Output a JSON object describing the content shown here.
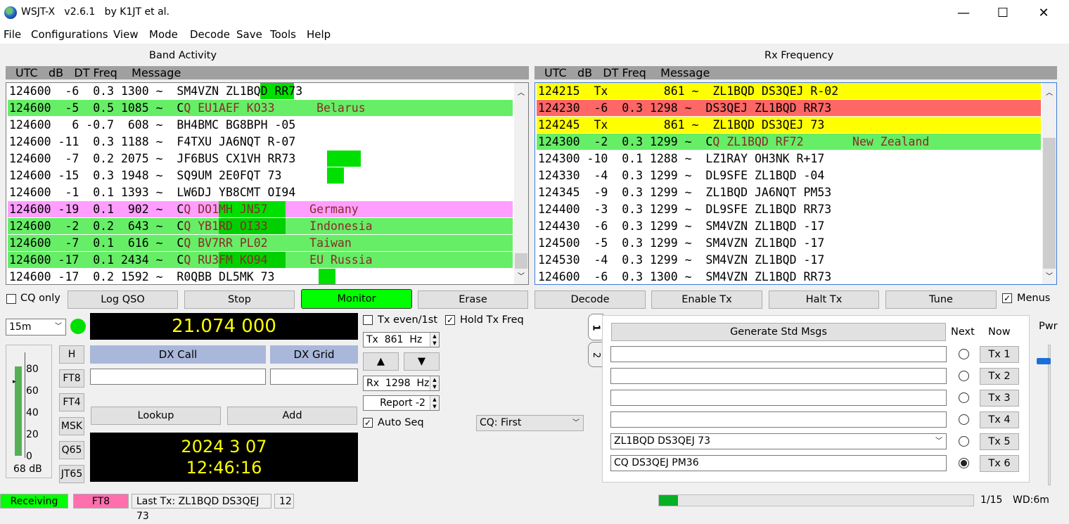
{
  "title": "WSJT-X   v2.6.1   by K1JT et al.",
  "window": {
    "minimize": "—",
    "maximize": "☐",
    "close": "✕"
  },
  "menu": [
    "File",
    "Configurations",
    "View",
    "Mode",
    "Decode",
    "Save",
    "Tools",
    "Help"
  ],
  "band": {
    "title": "Band Activity",
    "header": "UTC   dB   DT Freq    Message",
    "rows": [
      {
        "text": "124600  -6  0.3 1300 ~  SM4VZN ZL1BQD RR73",
        "bg": "#ffffff",
        "hl": [
          {
            "c": "#00e000",
            "from": 30,
            "len": 4
          }
        ]
      },
      {
        "text": "124600  -5  0.5 1085 ~  CQ EU1AEF KO33      Belarus",
        "bg": "#66ee66",
        "fg": "#8a2a2a",
        "hl": []
      },
      {
        "text": "124600   6 -0.7  608 ~  BH4BMC BG8BPH -05",
        "bg": "#ffffff",
        "hl": []
      },
      {
        "text": "124600 -11  0.3 1188 ~  F4TXU JA6NQT R-07",
        "bg": "#ffffff",
        "hl": []
      },
      {
        "text": "124600  -7  0.2 2075 ~  JF6BUS CX1VH RR73",
        "bg": "#ffffff",
        "hl": [
          {
            "c": "#00e000",
            "from": 38,
            "len": 4
          }
        ]
      },
      {
        "text": "124600 -15  0.3 1948 ~  SQ9UM 2E0FQT 73",
        "bg": "#ffffff",
        "hl": [
          {
            "c": "#00e000",
            "from": 38,
            "len": 2
          }
        ]
      },
      {
        "text": "124600  -1  0.1 1393 ~  LW6DJ YB8CMT OI94",
        "bg": "#ffffff",
        "hl": []
      },
      {
        "text": "124600 -19  0.1  902 ~  CQ DO1MH JN57      Germany",
        "bg": "#ff9eff",
        "fg": "#8a2a2a",
        "hl": [
          {
            "c": "#00e000",
            "from": 25,
            "len": 8
          }
        ]
      },
      {
        "text": "124600  -2  0.2  643 ~  CQ YB1RD OI33      Indonesia",
        "bg": "#66ee66",
        "fg": "#8a2a2a",
        "hl": [
          {
            "c": "#00d000",
            "from": 25,
            "len": 8
          }
        ]
      },
      {
        "text": "124600  -7  0.1  616 ~  CQ BV7RR PL02      Taiwan",
        "bg": "#66ee66",
        "fg": "#8a2a2a",
        "hl": []
      },
      {
        "text": "124600 -17  0.1 2434 ~  CQ RU3FM KO94      EU Russia",
        "bg": "#66ee66",
        "fg": "#8a2a2a",
        "hl": [
          {
            "c": "#00d000",
            "from": 25,
            "len": 8
          }
        ]
      },
      {
        "text": "124600 -17  0.2 1592 ~  R0QBB DL5MK 73",
        "bg": "#ffffff",
        "hl": [
          {
            "c": "#00e000",
            "from": 37,
            "len": 2
          }
        ]
      }
    ]
  },
  "rx": {
    "title": "Rx Frequency",
    "header": "UTC   dB   DT Freq    Message",
    "rows": [
      {
        "text": "124215  Tx        861 ~  ZL1BQD DS3QEJ R-02",
        "bg": "#ffff00"
      },
      {
        "text": "124230  -6  0.3 1298 ~  DS3QEJ ZL1BQD RR73",
        "bg": "#ff6666"
      },
      {
        "text": "124245  Tx        861 ~  ZL1BQD DS3QEJ 73",
        "bg": "#ffff00"
      },
      {
        "text": "124300  -2  0.3 1299 ~  CQ ZL1BQD RF72       New Zealand",
        "bg": "#66ee66",
        "fg": "#8a2a2a"
      },
      {
        "text": "124300 -10  0.1 1288 ~  LZ1RAY OH3NK R+17",
        "bg": "#ffffff"
      },
      {
        "text": "124330  -4  0.3 1299 ~  DL9SFE ZL1BQD -04",
        "bg": "#ffffff"
      },
      {
        "text": "124345  -9  0.3 1299 ~  ZL1BQD JA6NQT PM53",
        "bg": "#ffffff"
      },
      {
        "text": "124400  -3  0.3 1299 ~  DL9SFE ZL1BQD RR73",
        "bg": "#ffffff"
      },
      {
        "text": "124430  -6  0.3 1299 ~  SM4VZN ZL1BQD -17",
        "bg": "#ffffff"
      },
      {
        "text": "124500  -5  0.3 1299 ~  SM4VZN ZL1BQD -17",
        "bg": "#ffffff"
      },
      {
        "text": "124530  -4  0.3 1299 ~  SM4VZN ZL1BQD -17",
        "bg": "#ffffff"
      },
      {
        "text": "124600  -6  0.3 1300 ~  SM4VZN ZL1BQD RR73",
        "bg": "#ffffff"
      }
    ]
  },
  "controls": {
    "cq_only": "CQ only",
    "log_qso": "Log QSO",
    "stop": "Stop",
    "monitor": "Monitor",
    "erase": "Erase",
    "decode": "Decode",
    "enable_tx": "Enable Tx",
    "halt_tx": "Halt Tx",
    "tune": "Tune",
    "menus": "Menus"
  },
  "band_select": "15m",
  "frequency": "21.074 000",
  "dx": {
    "call_label": "DX Call",
    "grid_label": "DX Grid",
    "lookup": "Lookup",
    "add": "Add"
  },
  "modes": [
    "H",
    "FT8",
    "FT4",
    "MSK",
    "Q65",
    "JT65"
  ],
  "meter": {
    "ticks": [
      "80",
      "60",
      "40",
      "20",
      "0"
    ],
    "level": "68 dB"
  },
  "datetime": {
    "date": "2024 3 07",
    "time": "12:46:16"
  },
  "tx": {
    "even_label": "Tx even/1st",
    "hold_label": "Hold Tx Freq",
    "tx_freq": "Tx  861  Hz",
    "up": "▲",
    "down": "▼",
    "rx_freq": "Rx  1298  Hz",
    "report": "Report -2",
    "auto_seq": "Auto Seq",
    "cq_select": "CQ: First"
  },
  "msgs": {
    "tab1": "1",
    "tab2": "2",
    "generate": "Generate Std Msgs",
    "next": "Next",
    "now": "Now",
    "pwr": "Pwr",
    "items": [
      {
        "text": "",
        "btn": "Tx 1",
        "sel": false
      },
      {
        "text": "",
        "btn": "Tx 2",
        "sel": false
      },
      {
        "text": "",
        "btn": "Tx 3",
        "sel": false
      },
      {
        "text": "",
        "btn": "Tx 4",
        "sel": false
      },
      {
        "text": "ZL1BQD DS3QEJ 73",
        "btn": "Tx 5",
        "sel": false
      },
      {
        "text": "CQ DS3QEJ PM36",
        "btn": "Tx 6",
        "sel": true
      }
    ]
  },
  "statusbar": {
    "receiving": "Receiving",
    "mode": "FT8",
    "last_tx": "Last Tx: ZL1BQD DS3QEJ 73",
    "count": "12",
    "page": "1/15",
    "wd": "WD:6m"
  }
}
